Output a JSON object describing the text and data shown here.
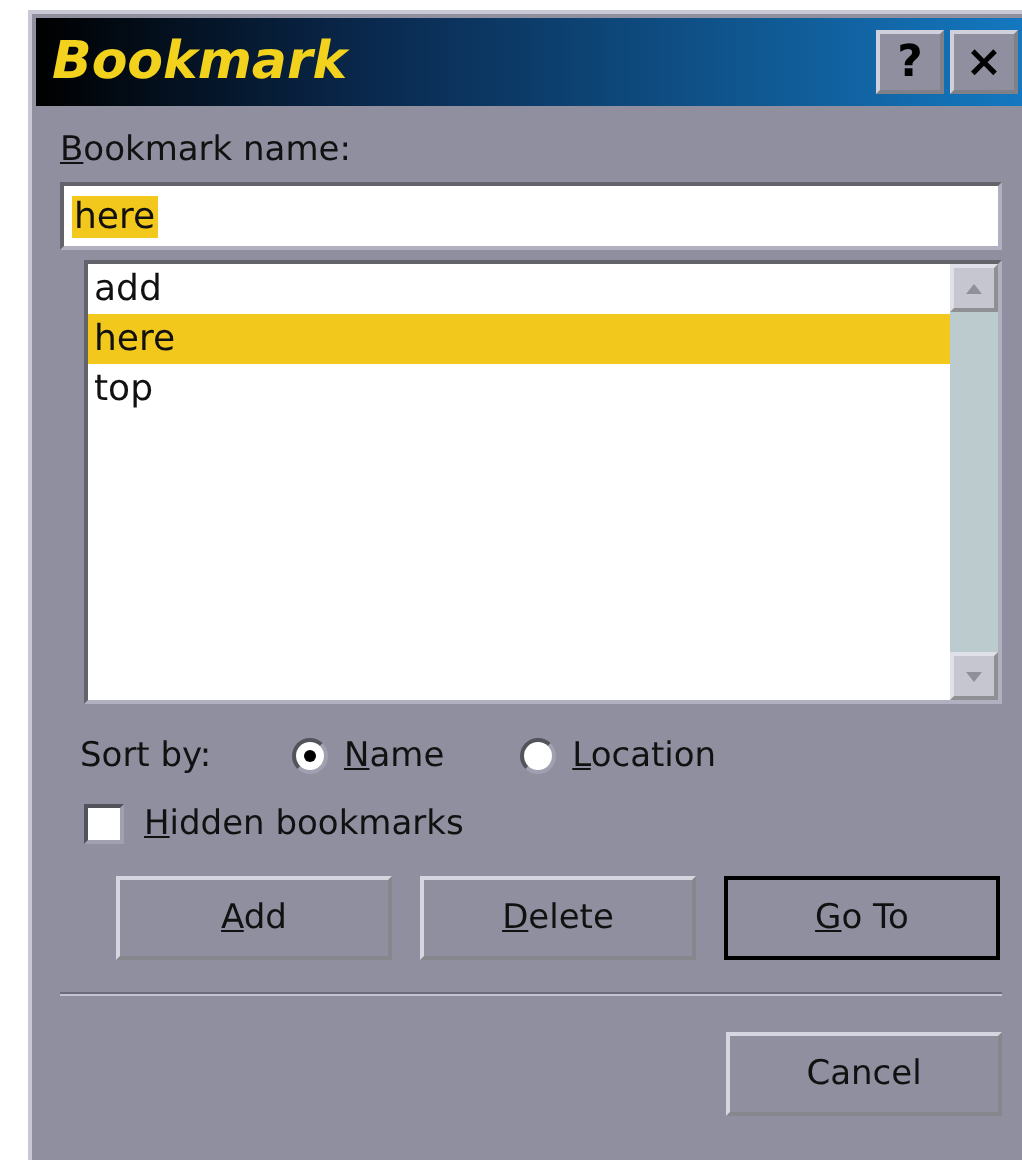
{
  "window": {
    "title": "Bookmark",
    "title_buttons": [
      "?",
      "×"
    ]
  },
  "name_field": {
    "label": "Bookmark name:",
    "label_underline_first": true,
    "value": "here",
    "value_selected": true
  },
  "bookmarks": [
    {
      "label": "add",
      "selected": false
    },
    {
      "label": "here",
      "selected": true
    },
    {
      "label": "top",
      "selected": false
    }
  ],
  "sort": {
    "label": "Sort by:",
    "options": [
      {
        "label": "Name",
        "selected": true,
        "underline_first": true
      },
      {
        "label": "Location",
        "selected": false,
        "underline_first": true
      }
    ]
  },
  "hidden_bookmarks": {
    "label": "Hidden bookmarks",
    "checked": false,
    "underline_first": true
  },
  "buttons": [
    {
      "label": "Add",
      "default": false,
      "underline_first": true
    },
    {
      "label": "Delete",
      "default": false,
      "underline_first": true
    },
    {
      "label": "Go To",
      "default": true,
      "underline_first": true
    }
  ],
  "footer_buttons": [
    {
      "label": "Cancel",
      "default": false,
      "underline_first": false
    }
  ]
}
